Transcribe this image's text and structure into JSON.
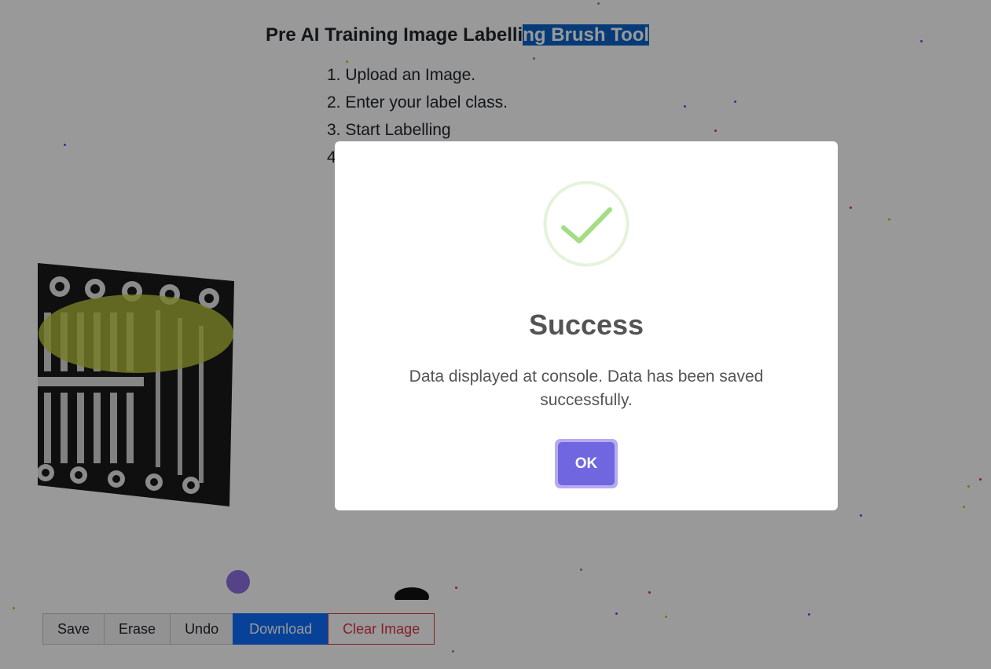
{
  "page": {
    "title_prefix": "Pre AI Training Image Labelli",
    "title_selected": "ng Brush Tool",
    "steps": [
      "1. Upload an Image.",
      "2. Enter your label class.",
      "3. Start Labelling",
      "4"
    ]
  },
  "toolbar": {
    "save_label": "Save",
    "erase_label": "Erase",
    "undo_label": "Undo",
    "download_label": "Download",
    "clear_label": "Clear Image"
  },
  "modal": {
    "icon": "success-check-icon",
    "title": "Success",
    "message": "Data displayed at console. Data has been saved successfully.",
    "ok_label": "OK"
  },
  "colors": {
    "primary": "#0d6efd",
    "danger": "#dc3545",
    "confirm": "#7066e0",
    "success": "#a5dc86",
    "selection": "#0b63c8",
    "label_highlight": "#b9c83a",
    "brush": "#8f6fe0"
  }
}
